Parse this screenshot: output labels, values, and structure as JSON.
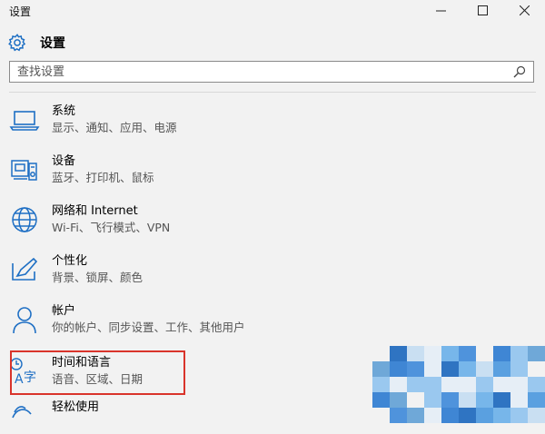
{
  "window": {
    "title": "设置"
  },
  "header": {
    "title": "设置"
  },
  "search": {
    "placeholder": "查找设置"
  },
  "items": [
    {
      "name": "系统",
      "desc": "显示、通知、应用、电源",
      "icon": "laptop-icon"
    },
    {
      "name": "设备",
      "desc": "蓝牙、打印机、鼠标",
      "icon": "devices-icon"
    },
    {
      "name": "网络和 Internet",
      "desc": "Wi-Fi、飞行模式、VPN",
      "icon": "globe-icon"
    },
    {
      "name": "个性化",
      "desc": "背景、锁屏、颜色",
      "icon": "personalization-icon"
    },
    {
      "name": "帐户",
      "desc": "你的帐户、同步设置、工作、其他用户",
      "icon": "person-icon"
    },
    {
      "name": "时间和语言",
      "desc": "语音、区域、日期",
      "icon": "time-language-icon"
    },
    {
      "name": "轻松使用",
      "desc": "",
      "icon": "ease-of-access-icon"
    }
  ],
  "colors": {
    "accent": "#1e6fc4",
    "highlight_border": "#d9342b",
    "background": "#f2f2f2"
  }
}
